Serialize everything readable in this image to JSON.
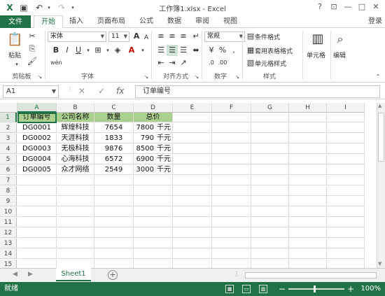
{
  "title_bar": {
    "title": "工作簿1.xlsx - Excel",
    "help": "?",
    "minimize": "—",
    "restore": "□",
    "close": "✕"
  },
  "tabs": {
    "file": "文件",
    "home": "开始",
    "insert": "插入",
    "page_layout": "页面布局",
    "formulas": "公式",
    "data": "数据",
    "review": "审阅",
    "view": "视图",
    "sign_in": "登录"
  },
  "ribbon": {
    "clipboard": {
      "label": "剪贴板",
      "paste": "粘贴"
    },
    "font": {
      "label": "字体",
      "font_name": "宋体",
      "font_size": "11",
      "bold": "B",
      "italic": "I",
      "underline": "U",
      "grow": "A",
      "shrink": "A",
      "wen": "wén"
    },
    "alignment": {
      "label": "对齐方式"
    },
    "number": {
      "label": "数字",
      "format": "常规",
      "percent": "%",
      "comma": ","
    },
    "styles": {
      "label": "样式",
      "conditional": "条件格式",
      "table": "套用表格格式",
      "cell_styles": "单元格样式"
    },
    "cells": {
      "label": "单元格"
    },
    "editing": {
      "label": "编辑"
    }
  },
  "formula_bar": {
    "name_box": "A1",
    "fx": "fx",
    "content": "订单编号"
  },
  "columns": [
    "A",
    "B",
    "C",
    "D",
    "E",
    "F",
    "G",
    "H",
    "I"
  ],
  "rows": [
    "1",
    "2",
    "3",
    "4",
    "5",
    "6",
    "7",
    "8",
    "9",
    "10",
    "11",
    "12",
    "13",
    "14",
    "15",
    "16",
    "17"
  ],
  "table": {
    "headers": [
      "订单编号",
      "公司名称",
      "数量",
      "总价"
    ],
    "rows": [
      [
        "DG0001",
        "辉煌科技",
        "7654",
        "7800",
        "千元"
      ],
      [
        "DG0002",
        "天涯科技",
        "1833",
        "790",
        "千元"
      ],
      [
        "DG0003",
        "无极科技",
        "9876",
        "8500",
        "千元"
      ],
      [
        "DG0004",
        "心海科技",
        "6572",
        "6900",
        "千元"
      ],
      [
        "DG0005",
        "众才网络",
        "2549",
        "3000",
        "千元"
      ]
    ]
  },
  "sheet_tabs": {
    "sheet1": "Sheet1",
    "add": "+"
  },
  "status_bar": {
    "ready": "就绪",
    "zoom": "100%",
    "zoom_out": "−",
    "zoom_in": "+"
  },
  "colors": {
    "accent": "#217346",
    "header_fill": "#a9d08e"
  }
}
